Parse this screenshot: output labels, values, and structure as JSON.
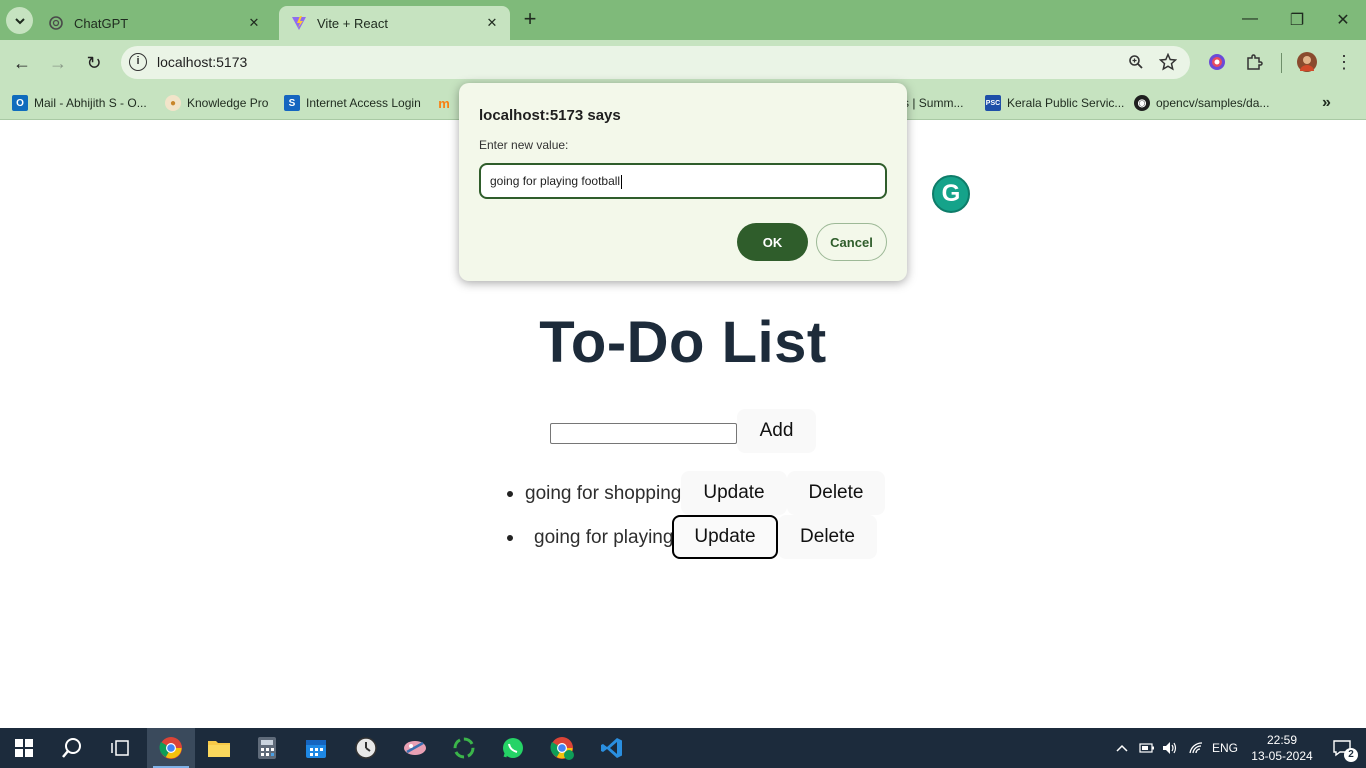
{
  "browser": {
    "tabs": [
      {
        "title": "ChatGPT",
        "icon": "chatgpt-icon"
      },
      {
        "title": "Vite + React",
        "icon": "vite-icon",
        "active": true
      }
    ],
    "url": "localhost:5173",
    "bookmarks": [
      {
        "label": "Mail - Abhijith S - O...",
        "icon": "outlook-icon",
        "color": "#0f6cbd"
      },
      {
        "label": "Knowledge Pro",
        "icon": "knowledge-pro-icon",
        "color": "#e9a23b"
      },
      {
        "label": "Internet Access Login",
        "icon": "login-icon",
        "color": "#1565c0"
      },
      {
        "label": "",
        "icon": "moodle-icon",
        "color": "#f98012"
      },
      {
        "label": "s | Summ...",
        "icon": "summary-icon",
        "color": "#555"
      },
      {
        "label": "Kerala Public Servic...",
        "icon": "kpsc-icon",
        "color": "#1e4fa8"
      },
      {
        "label": "opencv/samples/da...",
        "icon": "github-icon",
        "color": "#1f1f1f"
      }
    ]
  },
  "dialog": {
    "title": "localhost:5173 says",
    "message": "Enter new value:",
    "input_value": "going for playing football",
    "ok_label": "OK",
    "cancel_label": "Cancel"
  },
  "app": {
    "title": "To-Do List",
    "add_label": "Add",
    "items": [
      {
        "text": "going for shopping",
        "update_label": "Update",
        "delete_label": "Delete"
      },
      {
        "text": "going for playing",
        "update_label": "Update",
        "delete_label": "Delete"
      }
    ]
  },
  "taskbar": {
    "language": "ENG",
    "time": "22:59",
    "date": "13-05-2024",
    "notification_count": "2"
  },
  "colors": {
    "chrome_frame": "#7fba7a",
    "chrome_toolbar": "#c6e3c0",
    "dialog_accent": "#2f5d2b",
    "title_text": "#1d2b3a"
  }
}
